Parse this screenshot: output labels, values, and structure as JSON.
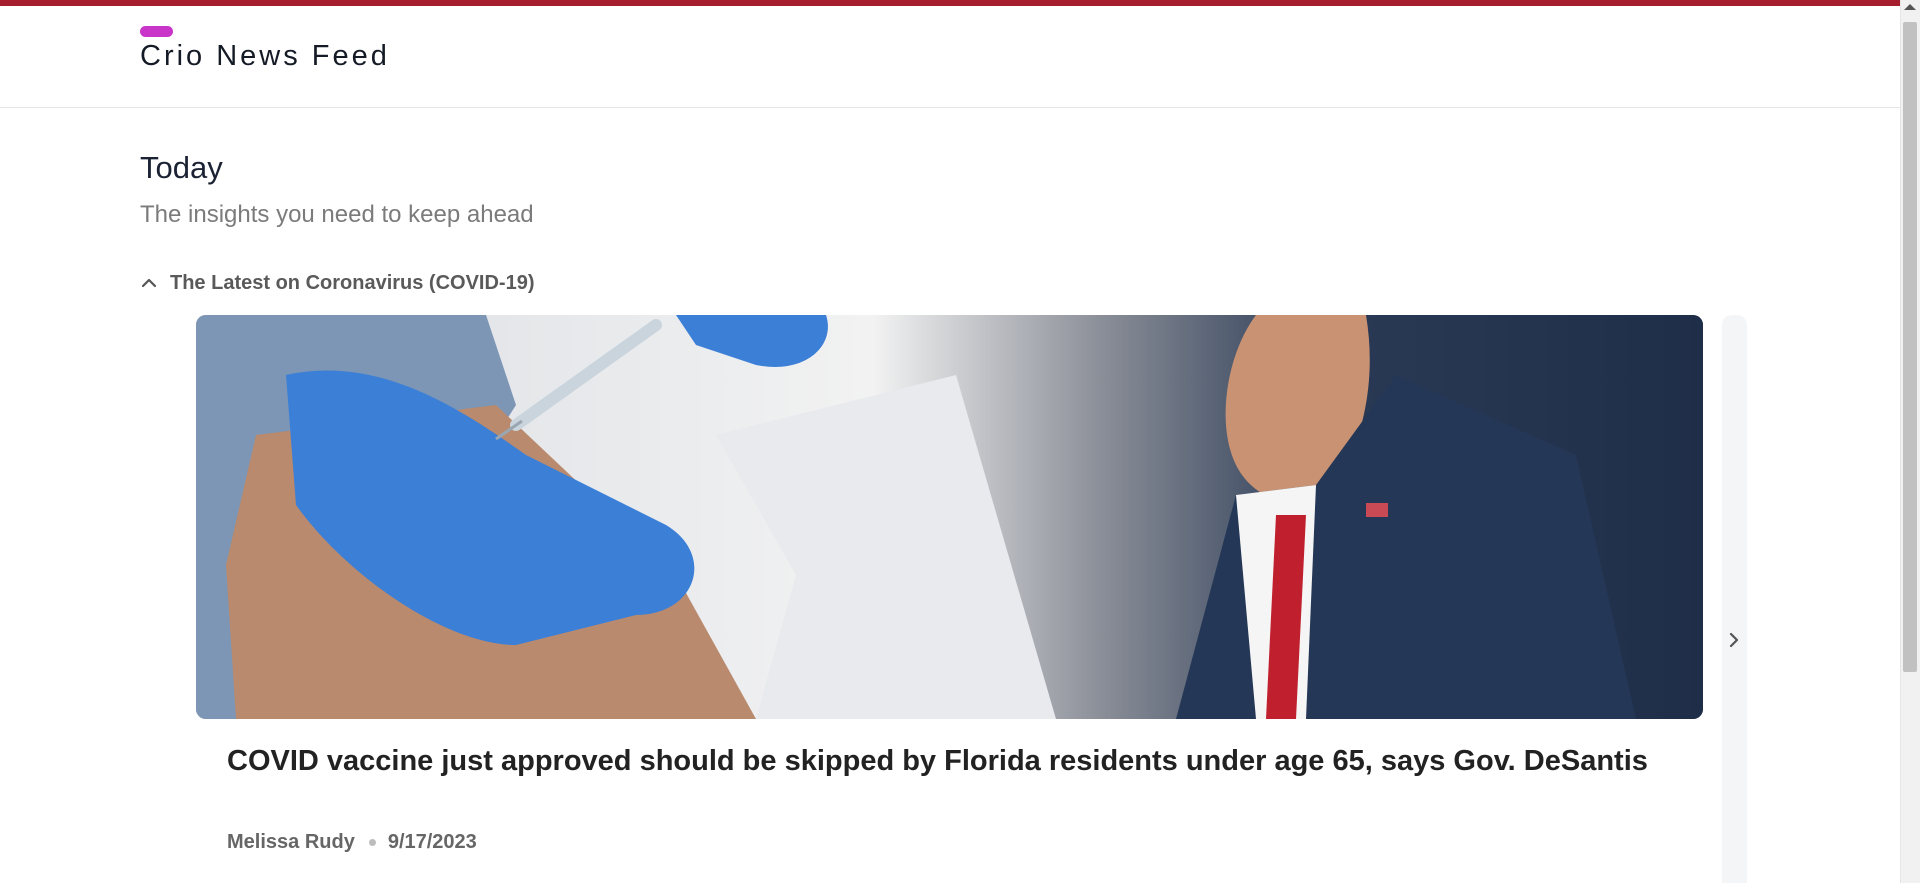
{
  "brand": {
    "title": "Crio News Feed",
    "accent_color": "#c935c9",
    "top_strip_color": "#a61e2d"
  },
  "section": {
    "title": "Today",
    "subtitle": "The insights you need to keep ahead"
  },
  "accordion": {
    "icon": "chevron-up-icon",
    "label": "The Latest on Coronavirus (COVID-19)",
    "expanded": true
  },
  "carousel": {
    "next_icon": "chevron-right-icon",
    "items": [
      {
        "image_alt": "vaccine-injection-and-politician-portrait",
        "title": "COVID vaccine just approved should be skipped by Florida residents under age 65, says Gov. DeSantis",
        "author": "Melissa Rudy",
        "date": "9/17/2023"
      }
    ]
  }
}
